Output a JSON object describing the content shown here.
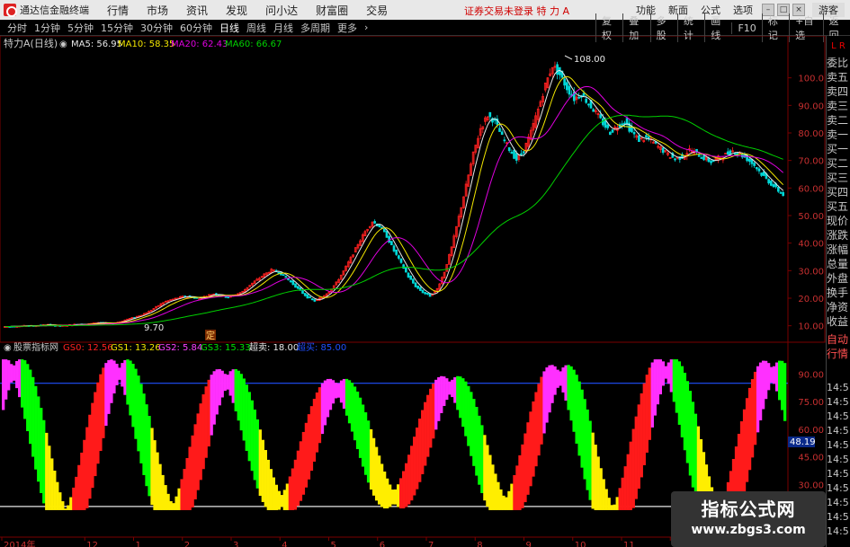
{
  "titlebar": {
    "app_name": "通达信金融终端",
    "menus": [
      "行情",
      "市场",
      "资讯",
      "发现",
      "问小达",
      "财富圈",
      "交易"
    ],
    "login_status": "证券交易未登录  特 力 A",
    "right_menu": [
      "功能",
      "新面",
      "公式",
      "选项"
    ],
    "guest": "游客"
  },
  "toolbar": {
    "periods": [
      "分时",
      "1分钟",
      "5分钟",
      "15分钟",
      "30分钟",
      "60分钟",
      "日线",
      "周线",
      "月线",
      "多周期",
      "更多"
    ],
    "active_period": "日线",
    "right_buttons": [
      "复权",
      "叠加",
      "多股",
      "统计",
      "画线",
      "F10",
      "标记",
      "+自选",
      "返回"
    ]
  },
  "main_chart": {
    "stock_label": "特力A(日线)",
    "ma": [
      {
        "label": "MA5: 56.95",
        "color": "#e8e8e8"
      },
      {
        "label": "MA10: 58.35",
        "color": "#f2e600"
      },
      {
        "label": "MA20: 62.43",
        "color": "#e000e0"
      },
      {
        "label": "MA60: 66.67",
        "color": "#00d000"
      }
    ],
    "y_ticks": [
      "100.0",
      "90.00",
      "80.00",
      "70.00",
      "60.00",
      "50.00",
      "40.00",
      "30.00",
      "20.00",
      "10.00"
    ],
    "high_label": "108.00",
    "low_label": "9.70",
    "marker": "定"
  },
  "sub_chart": {
    "title": "股票指标网",
    "params": [
      {
        "label": "GS0: 12.56",
        "color": "#ff2020"
      },
      {
        "label": "GS1: 13.26",
        "color": "#f2e600"
      },
      {
        "label": "GS2: 5.84",
        "color": "#ff40ff"
      },
      {
        "label": "GS3: 15.33",
        "color": "#00e000"
      },
      {
        "label": "超卖: 18.00",
        "color": "#e8e8e8"
      },
      {
        "label": "超买: 85.00",
        "color": "#2050ff"
      }
    ],
    "y_ticks": [
      "90.00",
      "75.00",
      "60.00",
      "45.00",
      "30.00"
    ],
    "current_value": "48.19"
  },
  "time_axis": [
    "2014年",
    "12",
    "1",
    "2",
    "3",
    "4",
    "5",
    "6",
    "7",
    "8",
    "9",
    "10",
    "11",
    "12",
    "1",
    "2"
  ],
  "quote_panel": {
    "badge": "L R",
    "labels": [
      "委比",
      "卖五",
      "卖四",
      "卖三",
      "卖二",
      "卖一",
      "买一",
      "买二",
      "买三",
      "买四",
      "买五",
      "现价",
      "涨跌",
      "涨幅",
      "总量",
      "外盘",
      "换手",
      "净资",
      "收益",
      "自动",
      "行情"
    ],
    "times": [
      "14:5",
      "14:5",
      "14:5",
      "14:5",
      "14:5",
      "14:5",
      "14:5",
      "14:5",
      "14:5",
      "14:5",
      "14:5"
    ]
  },
  "watermark": {
    "title": "指标公式网",
    "url": "www.zbgs3.com"
  },
  "colors": {
    "up": "#ff2020",
    "down": "#00d8d8",
    "ma5": "#e8e8e8",
    "ma10": "#f2e600",
    "ma20": "#e000e0",
    "ma60": "#00d000",
    "gs_red": "#ff1a1a",
    "gs_yellow": "#ffee00",
    "gs_magenta": "#ff30ff",
    "gs_green": "#00ff00",
    "overbought_line": "#2050ff",
    "oversold_line": "#e8e8e8"
  },
  "chart_data": {
    "type": "line",
    "title": "特力A(日线)",
    "ylim": [
      5,
      110
    ],
    "closes": [
      9.7,
      9.8,
      9.9,
      10.1,
      10.0,
      10.2,
      10.4,
      10.1,
      10.0,
      10.3,
      10.6,
      10.4,
      10.8,
      11.2,
      11.0,
      10.9,
      11.5,
      12.4,
      13.1,
      14.0,
      15.2,
      16.8,
      18.5,
      19.4,
      20.1,
      20.8,
      20.4,
      19.8,
      20.9,
      21.6,
      21.0,
      20.5,
      21.3,
      22.4,
      24.8,
      26.7,
      28.6,
      30.2,
      29.4,
      27.5,
      25.1,
      22.6,
      20.3,
      19.0,
      20.4,
      22.5,
      25.6,
      29.8,
      34.5,
      39.6,
      44.2,
      47.8,
      46.1,
      42.5,
      37.2,
      32.6,
      27.8,
      24.3,
      22.1,
      20.8,
      23.4,
      29.6,
      38.4,
      49.5,
      60.8,
      72.3,
      81.6,
      86.4,
      84.2,
      78.6,
      74.1,
      70.3,
      73.6,
      80.2,
      88.5,
      97.4,
      104.5,
      101.2,
      96.3,
      92.4,
      94.1,
      90.6,
      87.4,
      83.5,
      80.2,
      82.6,
      84.1,
      80.3,
      77.5,
      78.2,
      76.4,
      74.3,
      72.1,
      70.6,
      71.4,
      73.8,
      72.6,
      70.9,
      69.5,
      70.8,
      72.1,
      73.5,
      72.4,
      70.6,
      68.3,
      65.1,
      62.4,
      59.8,
      57.6
    ]
  }
}
